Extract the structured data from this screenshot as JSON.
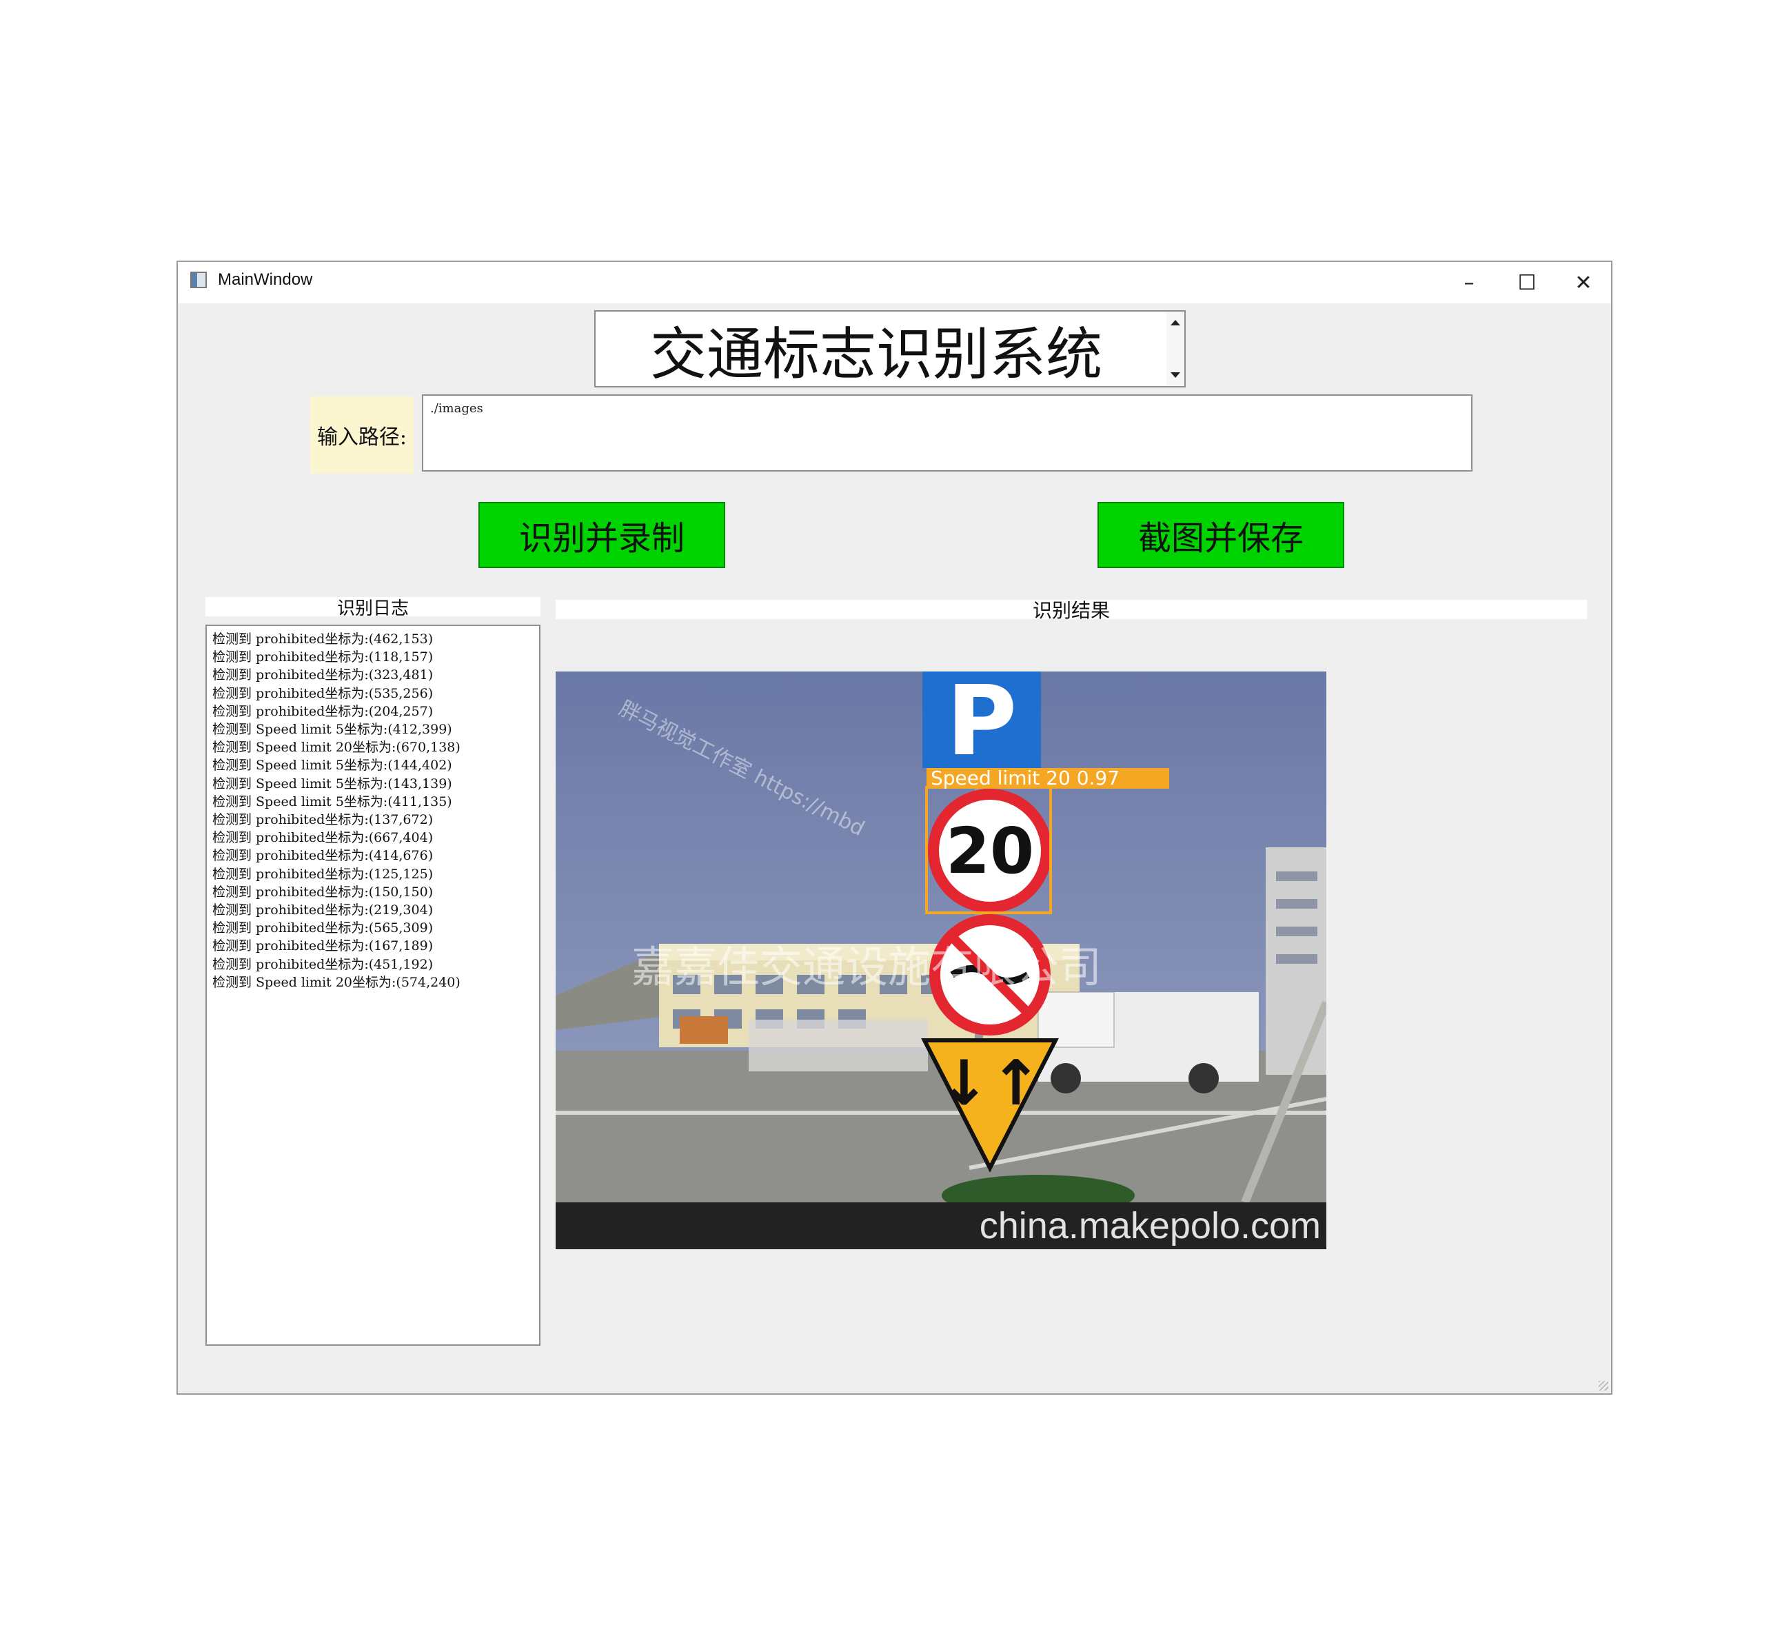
{
  "window": {
    "title": "MainWindow",
    "controls": {
      "minimize": "–",
      "maximize": "☐",
      "close": "✕"
    }
  },
  "app": {
    "title": "交通标志识别系统"
  },
  "input": {
    "label": "输入路径:",
    "value": "./images"
  },
  "buttons": {
    "record": "识别并录制",
    "screenshot": "截图并保存"
  },
  "log": {
    "header": "识别日志",
    "lines": [
      "检测到 prohibited坐标为:(462,153)",
      "检测到 prohibited坐标为:(118,157)",
      "检测到 prohibited坐标为:(323,481)",
      "检测到 prohibited坐标为:(535,256)",
      "检测到 prohibited坐标为:(204,257)",
      "检测到 Speed limit 5坐标为:(412,399)",
      "检测到 Speed limit 20坐标为:(670,138)",
      "检测到 Speed limit 5坐标为:(144,402)",
      "检测到 Speed limit 5坐标为:(143,139)",
      "检测到 Speed limit 5坐标为:(411,135)",
      "检测到 prohibited坐标为:(137,672)",
      "检测到 prohibited坐标为:(667,404)",
      "检测到 prohibited坐标为:(414,676)",
      "检测到 prohibited坐标为:(125,125)",
      "检测到 prohibited坐标为:(150,150)",
      "检测到 prohibited坐标为:(219,304)",
      "检测到 prohibited坐标为:(565,309)",
      "检测到 prohibited坐标为:(167,189)",
      "检测到 prohibited坐标为:(451,192)",
      "检测到 Speed limit 20坐标为:(574,240)"
    ]
  },
  "result": {
    "header": "识别结果",
    "detection_label": "Speed limit 20 0.97",
    "sign_number": "20",
    "watermark_diag": "胖马视觉工作室 https://mbd",
    "watermark_company": "嘉嘉佳交通设施有限公司",
    "watermark_site": "china.makepolo.com",
    "colors": {
      "detection_box": "#f5a623",
      "sky": "#6f7ea8",
      "ground": "#8f8f8b",
      "sign_blue": "#1f6fd0"
    }
  }
}
